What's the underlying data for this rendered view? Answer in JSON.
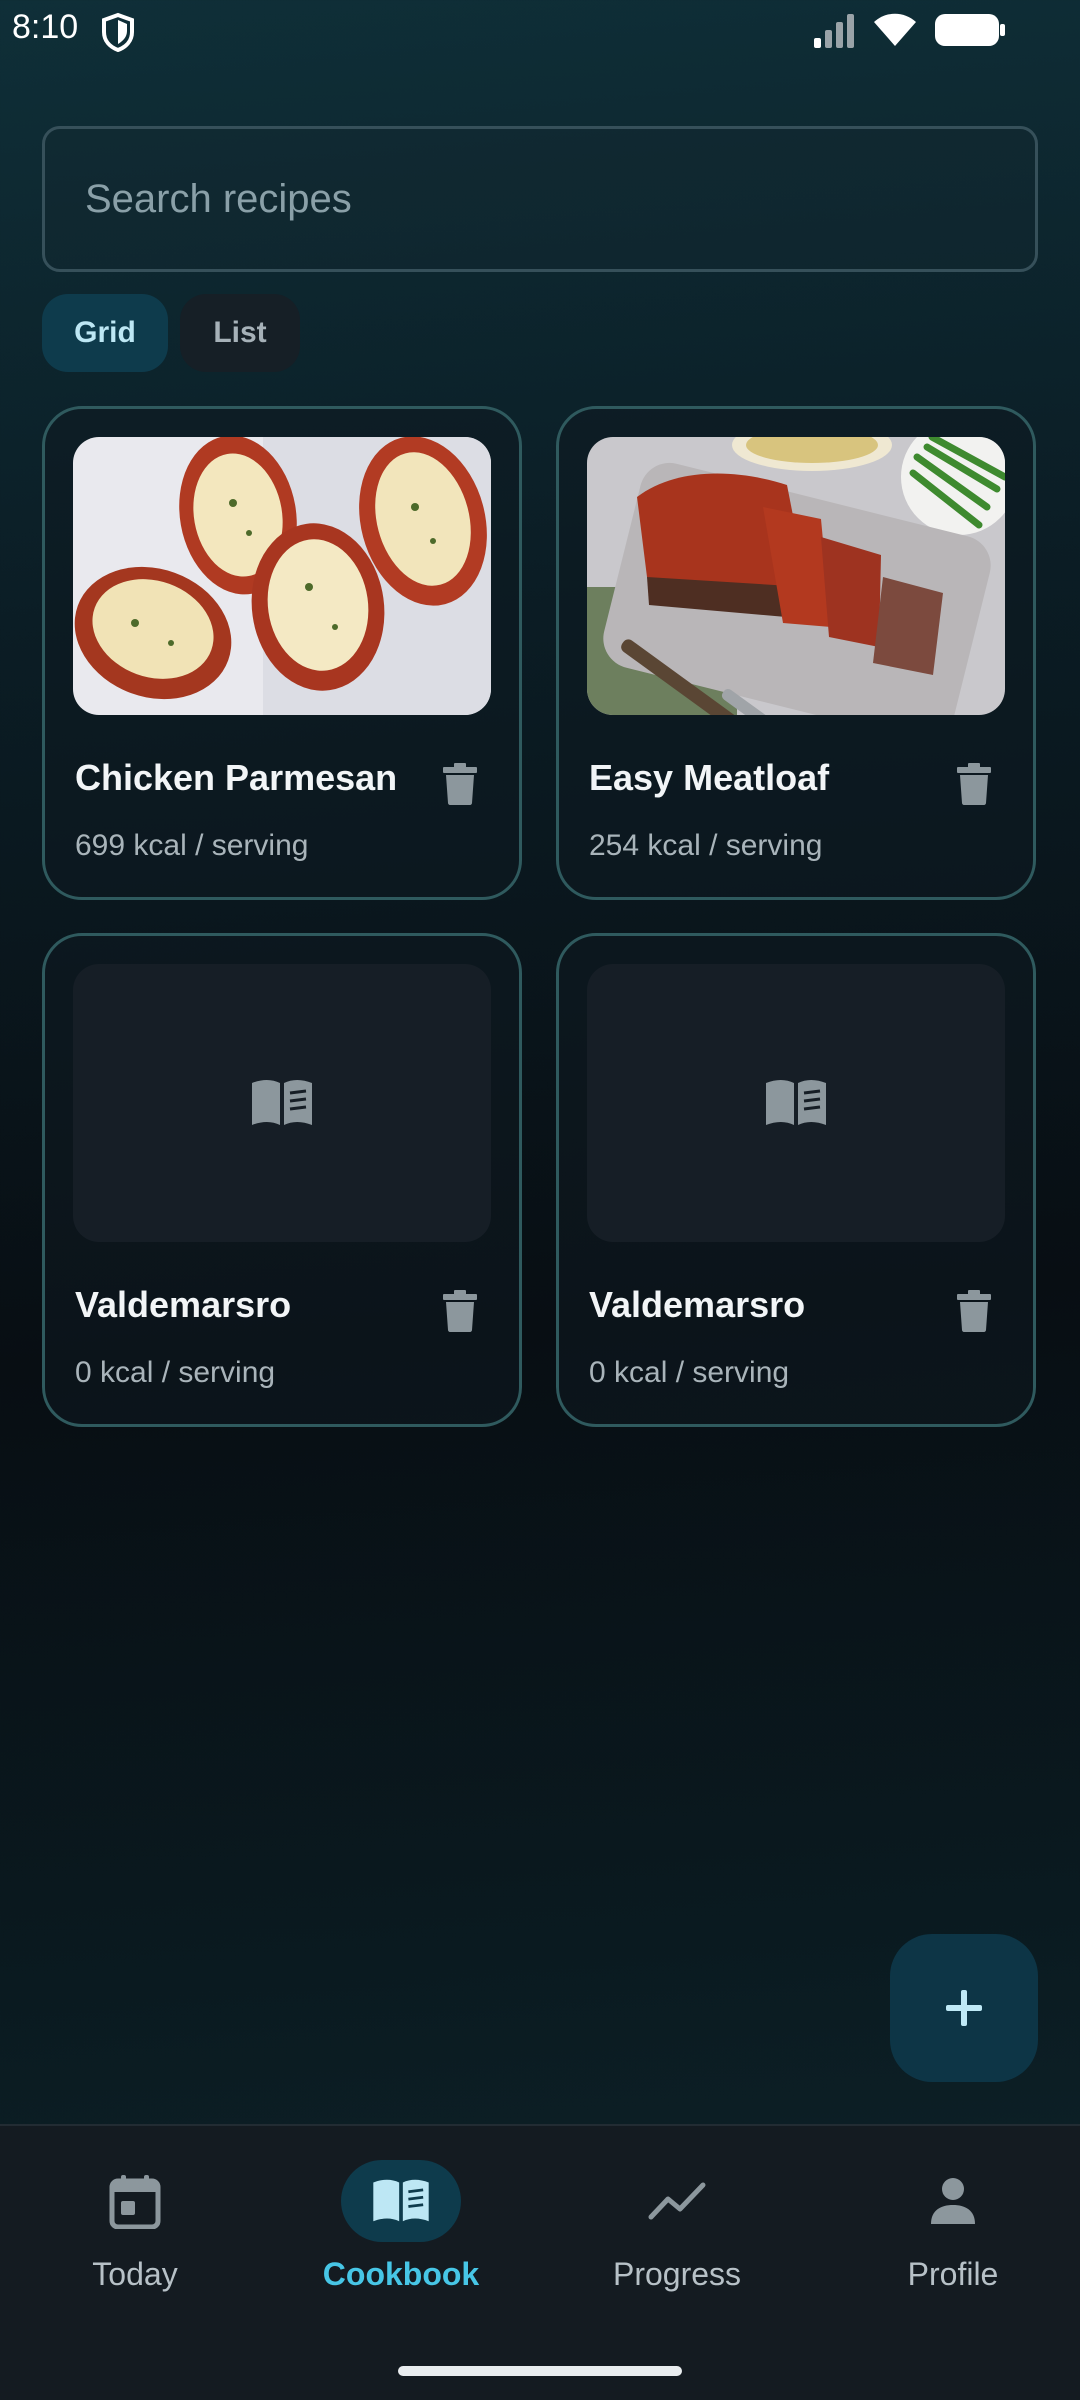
{
  "status_bar": {
    "time": "8:10"
  },
  "search": {
    "placeholder": "Search recipes"
  },
  "view_toggle": {
    "grid_label": "Grid",
    "list_label": "List",
    "selected": "Grid"
  },
  "recipes": [
    {
      "title": "Chicken Parmesan",
      "kcal": "699 kcal / serving",
      "image": "chicken-parmesan-photo"
    },
    {
      "title": "Easy Meatloaf",
      "kcal": "254 kcal / serving",
      "image": "meatloaf-photo"
    },
    {
      "title": "Valdemarsro",
      "kcal": "0 kcal / serving",
      "image": "book-icon"
    },
    {
      "title": "Valdemarsro",
      "kcal": "0 kcal / serving",
      "image": "book-icon"
    }
  ],
  "fab": {
    "icon": "plus-icon"
  },
  "nav": {
    "items": [
      {
        "label": "Today",
        "icon": "calendar-icon"
      },
      {
        "label": "Cookbook",
        "icon": "book-icon",
        "active": true
      },
      {
        "label": "Progress",
        "icon": "trend-icon"
      },
      {
        "label": "Profile",
        "icon": "person-icon"
      }
    ]
  },
  "colors": {
    "accent": "#47c6e6",
    "active_pill": "#0e3b4c",
    "card_border": "#2f5a5e"
  }
}
